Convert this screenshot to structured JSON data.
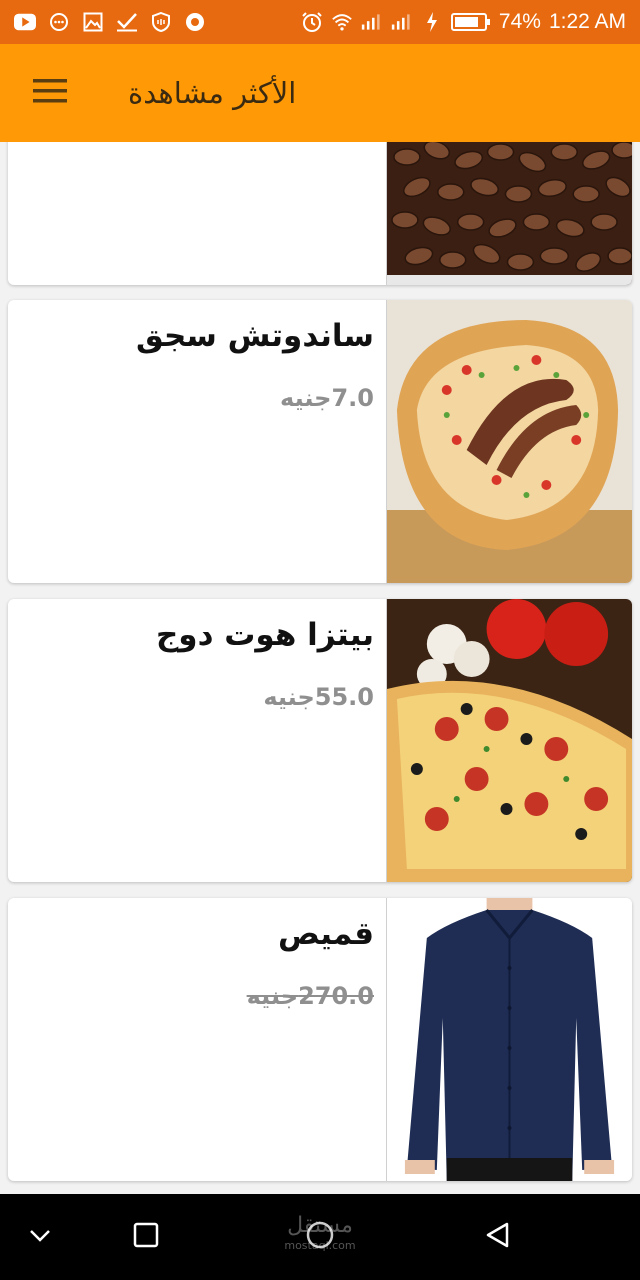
{
  "status_bar": {
    "battery": "74%",
    "time": "1:22 AM",
    "icons": [
      "youtube-icon",
      "messaging-icon",
      "image-icon",
      "check-icon",
      "shield-icon",
      "camera-icon",
      "alarm-icon",
      "wifi-icon",
      "signal-icon",
      "signal-icon",
      "charging-icon",
      "battery-icon"
    ]
  },
  "app_bar": {
    "title": "الأكثر مشاهدة",
    "menu_icon": "hamburger-menu-icon"
  },
  "products": [
    {
      "name": "",
      "price_value": "",
      "price_currency": "",
      "image": "dates-sweets-image",
      "struck": false
    },
    {
      "name": "ساندوتش سجق",
      "price_value": "7.0",
      "price_currency": "جنيه",
      "image": "sausage-sandwich-image",
      "struck": false
    },
    {
      "name": "بيتزا  هوت دوج",
      "price_value": "55.0",
      "price_currency": "جنيه",
      "image": "pizza-image",
      "struck": false
    },
    {
      "name": "قميص",
      "price_value": "270.0",
      "price_currency": "جنيه",
      "image": "navy-shirt-image",
      "struck": true
    }
  ],
  "nav_bar": {
    "watermark": "مستقل",
    "watermark_sub": "mostaql.com",
    "icons": [
      "chevron-down-icon",
      "recent-apps-icon",
      "home-icon",
      "back-icon"
    ]
  },
  "colors": {
    "status_bar": "#e86a10",
    "app_bar": "#ff9a06",
    "price_text": "#8f8f8f",
    "nav_bar": "#000000"
  }
}
